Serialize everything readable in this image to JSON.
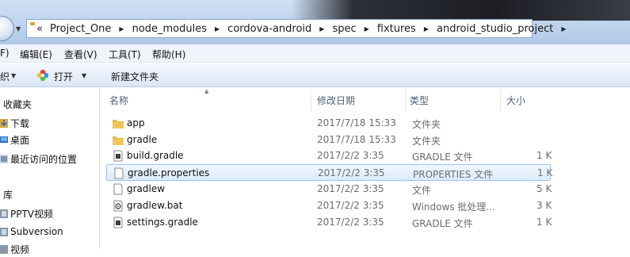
{
  "address": {
    "chevron": "«",
    "crumbs": [
      "Project_One",
      "node_modules",
      "cordova-android",
      "spec",
      "fixtures",
      "android_studio_project"
    ]
  },
  "menu": {
    "partial_file": "F)",
    "edit": "编辑(E)",
    "view": "查看(V)",
    "tools": "工具(T)",
    "help": "帮助(H)"
  },
  "toolbar": {
    "partial_organize": "织",
    "open": "打开",
    "new_folder": "新建文件夹"
  },
  "nav": {
    "favorites": "收藏夹",
    "downloads": "下载",
    "desktop": "桌面",
    "recent": "最近访问的位置",
    "library": "库",
    "pptv": "PPTV视频",
    "subversion": "Subversion",
    "partial_video": "视频"
  },
  "columns": {
    "name": "名称",
    "date": "修改日期",
    "type": "类型",
    "size": "大小"
  },
  "files": [
    {
      "name": "app",
      "date": "2017/7/18 15:33",
      "type": "文件夹",
      "size": "",
      "icon": "folder-icon"
    },
    {
      "name": "gradle",
      "date": "2017/7/18 15:33",
      "type": "文件夹",
      "size": "",
      "icon": "folder-icon"
    },
    {
      "name": "build.gradle",
      "date": "2017/2/2 3:35",
      "type": "GRADLE 文件",
      "size": "1 K",
      "icon": "gradle-file-icon"
    },
    {
      "name": "gradle.properties",
      "date": "2017/2/2 3:35",
      "type": "PROPERTIES 文件",
      "size": "1 K",
      "icon": "blank-file-icon"
    },
    {
      "name": "gradlew",
      "date": "2017/2/2 3:35",
      "type": "文件",
      "size": "5 K",
      "icon": "blank-file-icon"
    },
    {
      "name": "gradlew.bat",
      "date": "2017/2/2 3:35",
      "type": "Windows 批处理...",
      "size": "3 K",
      "icon": "batch-file-icon"
    },
    {
      "name": "settings.gradle",
      "date": "2017/2/2 3:35",
      "type": "GRADLE 文件",
      "size": "1 K",
      "icon": "gradle-file-icon"
    }
  ],
  "selected_index": 3,
  "colors": {
    "accent": "#3399ff",
    "selection_border": "#9ec3ee",
    "folder": "#e8b84a"
  }
}
